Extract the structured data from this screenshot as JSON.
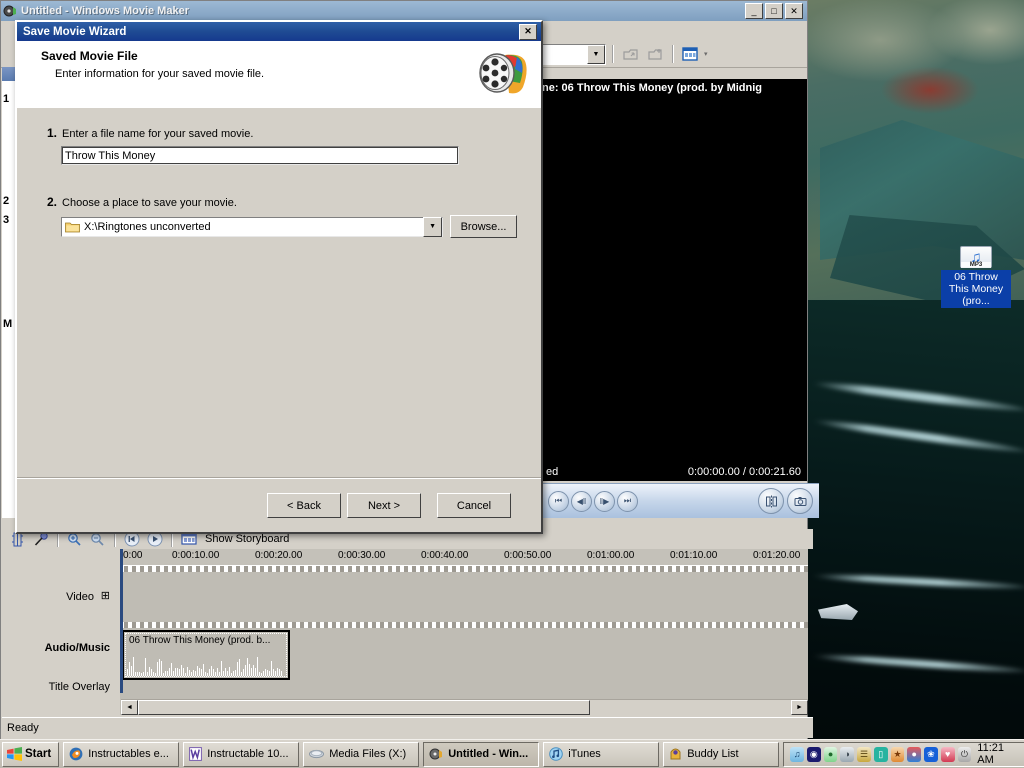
{
  "desktop": {
    "icon": {
      "name": "06 Throw This Money (pro...",
      "type_tag": "MP3",
      "glyph": "♫"
    }
  },
  "movie_maker": {
    "title": "Untitled - Windows Movie Maker",
    "window_buttons": {
      "minimize": "_",
      "maximize": "□",
      "close": "✕"
    },
    "toolbar": {
      "collection_value": "",
      "dropdown_arrow": "▼",
      "icons": [
        "import-icon",
        "new-collection-icon",
        "views-icon"
      ],
      "views_arrow": "▾"
    },
    "task_pane": {
      "items": [
        "1",
        "2",
        "3",
        "M"
      ]
    },
    "preview": {
      "caption": "ne: 06 Throw This Money (prod. by Midnig",
      "status": "ed",
      "time": "0:00:00.00 / 0:00:21.60",
      "controls": [
        "⏮",
        "◀‖",
        "‖▶",
        "⏭"
      ],
      "right_buttons": [
        "split-clip-icon",
        "take-picture-icon"
      ]
    },
    "timeline": {
      "toolbar_icons": [
        "set-narration-icon",
        "set-audio-levels-icon",
        "zoom-in-icon",
        "zoom-out-icon",
        "rewind-timeline-icon",
        "play-timeline-icon",
        "storyboard-icon"
      ],
      "storyboard_label": "Show Storyboard",
      "track_labels": [
        "Video",
        "Audio/Music",
        "Title Overlay"
      ],
      "expand_glyph": "⊞",
      "ruler_ticks": [
        "0:00",
        "0:00:10.00",
        "0:00:20.00",
        "0:00:30.00",
        "0:00:40.00",
        "0:00:50.00",
        "0:01:00.00",
        "0:01:10.00",
        "0:01:20.00"
      ],
      "clip_label": "06 Throw This Money (prod. b...",
      "scroll_left": "◄",
      "scroll_right": "►"
    },
    "status_bar": {
      "text": "Ready"
    }
  },
  "wizard": {
    "title": "Save Movie Wizard",
    "close_label": "✕",
    "heading": "Saved Movie File",
    "subheading": "Enter information for your saved movie file.",
    "step1": {
      "number": "1.",
      "label": "Enter a file name for your saved movie.",
      "value": "Throw This Money"
    },
    "step2": {
      "number": "2.",
      "label": "Choose a place to save your movie.",
      "value": "X:\\Ringtones unconverted",
      "browse_label": "Browse...",
      "dropdown_arrow": "▼"
    },
    "buttons": {
      "back": "< Back",
      "next": "Next >",
      "cancel": "Cancel"
    }
  },
  "taskbar": {
    "start": "Start",
    "items": [
      {
        "label": "Instructables e...",
        "icon": "firefox-icon",
        "active": false
      },
      {
        "label": "Instructable 10...",
        "icon": "word-icon",
        "active": false
      },
      {
        "label": "Media Files (X:)",
        "icon": "drive-icon",
        "active": false
      },
      {
        "label": "Untitled - Win...",
        "icon": "movie-maker-icon",
        "active": true
      },
      {
        "label": "iTunes",
        "icon": "itunes-icon",
        "active": false
      },
      {
        "label": "Buddy List",
        "icon": "aim-icon",
        "active": false
      }
    ],
    "tray_icons": [
      "itunes-tray-icon",
      "sound-tray-icon",
      "msn-tray-icon",
      "disc-tray-icon",
      "network-tray-icon",
      "clipboard-tray-icon",
      "firefox-tray-icon",
      "balls-tray-icon",
      "bluetooth-tray-icon",
      "antivirus-tray-icon",
      "power-tray-icon"
    ],
    "clock": "11:21 AM"
  },
  "colors": {
    "wizard_title": "#1f4b93",
    "mm_title": "#8fadcb",
    "chrome": "#d4d0c8",
    "selection_blue": "#0b3fa8"
  }
}
